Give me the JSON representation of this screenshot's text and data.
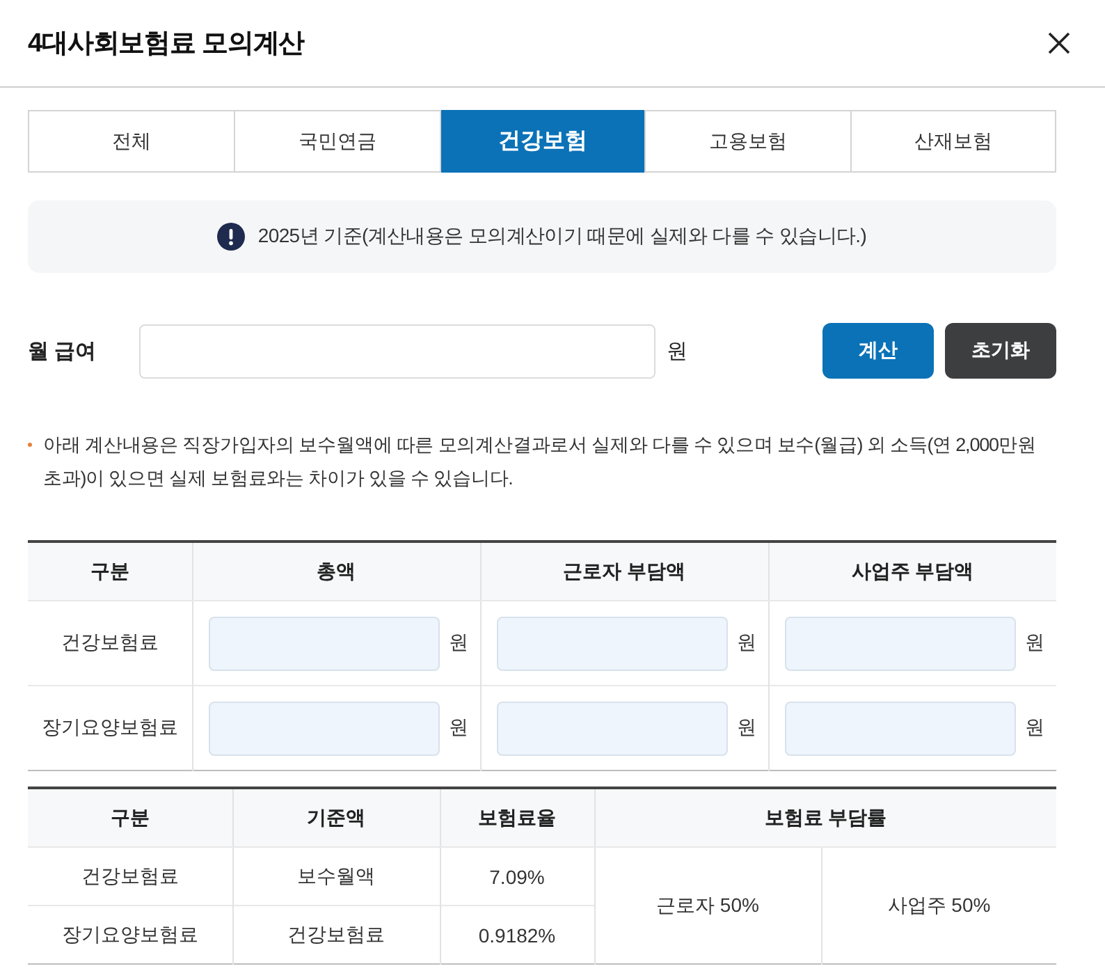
{
  "dialog": {
    "title": "4대사회보험료 모의계산"
  },
  "tabs": [
    {
      "label": "전체",
      "selected": false
    },
    {
      "label": "국민연금",
      "selected": false
    },
    {
      "label": "건강보험",
      "selected": true
    },
    {
      "label": "고용보험",
      "selected": false
    },
    {
      "label": "산재보험",
      "selected": false
    }
  ],
  "notice": {
    "text": "2025년 기준(계산내용은 모의계산이기 때문에 실제와 다를 수 있습니다.)"
  },
  "salary": {
    "label": "월 급여",
    "unit": "원"
  },
  "buttons": [
    {
      "label": "계산",
      "kind": "primary"
    },
    {
      "label": "초기화",
      "kind": "secondary"
    }
  ],
  "note": "아래 계산내용은 직장가입자의 보수월액에 따른 모의계산결과로서 실제와 다를 수 있으며 보수(월급) 외 소득(연 2,000만원 초과)이 있으면 실제 보험료와는 차이가 있을 수 있습니다.",
  "result_table": {
    "columns": [
      "구분",
      "총액",
      "근로자 부담액",
      "사업주 부담액"
    ],
    "rows": [
      {
        "label": "건강보험료",
        "units": [
          "원",
          "원",
          "원"
        ]
      },
      {
        "label": "장기요양보험료",
        "units": [
          "원",
          "원",
          "원"
        ]
      }
    ]
  },
  "rate_table": {
    "columns": [
      "구분",
      "기준액",
      "보험료율",
      "보험료 부담률"
    ],
    "rows": [
      [
        "건강보험료",
        "보수월액",
        "7.09%"
      ],
      [
        "장기요양보험료",
        "건강보험료",
        "0.9182%"
      ]
    ],
    "shares": [
      "근로자 50%",
      "사업주 50%"
    ]
  }
}
